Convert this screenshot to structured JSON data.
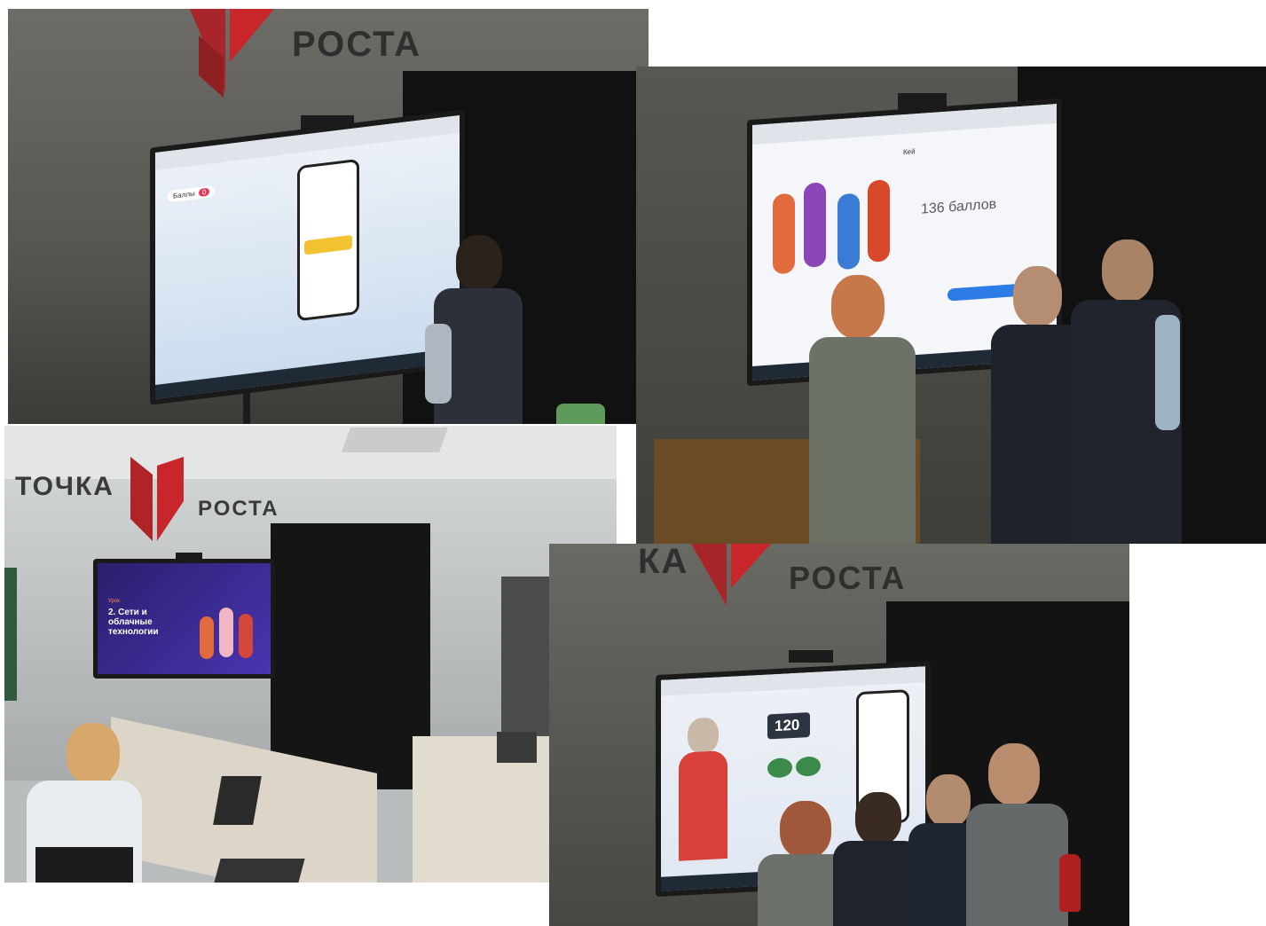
{
  "photos": [
    {
      "brand": {
        "left_word": "",
        "right_word": "РОСТА"
      },
      "screen": {
        "score_label": "Баллы",
        "score_value": "0"
      }
    },
    {
      "brand": {
        "left_word": "",
        "right_word": ""
      },
      "screen": {
        "result_score": "136 баллов",
        "header": "Кей"
      }
    },
    {
      "brand": {
        "left_word": "ТОЧКА",
        "right_word": "РОСТА"
      },
      "screen": {
        "lesson_tag": "Урок",
        "lesson_title": "2. Сети и облачные технологии"
      }
    },
    {
      "brand": {
        "left_word": "КА",
        "right_word": "РОСТА"
      },
      "screen": {
        "counter": "120"
      }
    }
  ],
  "colors": {
    "brand_red": "#c8262b",
    "wall_grey": "#8c8c88",
    "dark_panel": "#1a1a1a",
    "screen_blue": "#3b2c8f"
  }
}
